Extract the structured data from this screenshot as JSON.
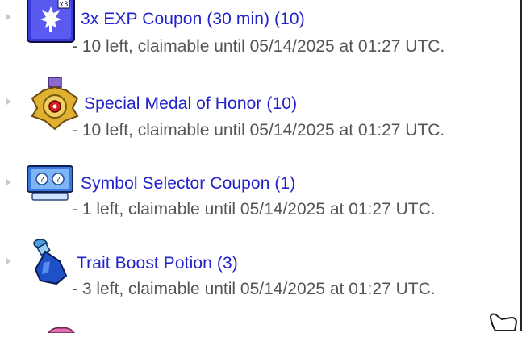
{
  "rewards": [
    {
      "name": "3x EXP Coupon (30 min) (10)",
      "detail": "- 10 left, claimable until 05/14/2025 at 01:27 UTC.",
      "icon": "exp-coupon-icon"
    },
    {
      "name": "Special Medal of Honor (10)",
      "detail": "- 10 left, claimable until 05/14/2025 at 01:27 UTC.",
      "icon": "medal-icon"
    },
    {
      "name": "Symbol Selector Coupon (1)",
      "detail": "- 1 left, claimable until 05/14/2025 at 01:27 UTC.",
      "icon": "symbol-selector-icon"
    },
    {
      "name": "Trait Boost Potion (3)",
      "detail": "- 3 left, claimable until 05/14/2025 at 01:27 UTC.",
      "icon": "potion-icon"
    }
  ]
}
